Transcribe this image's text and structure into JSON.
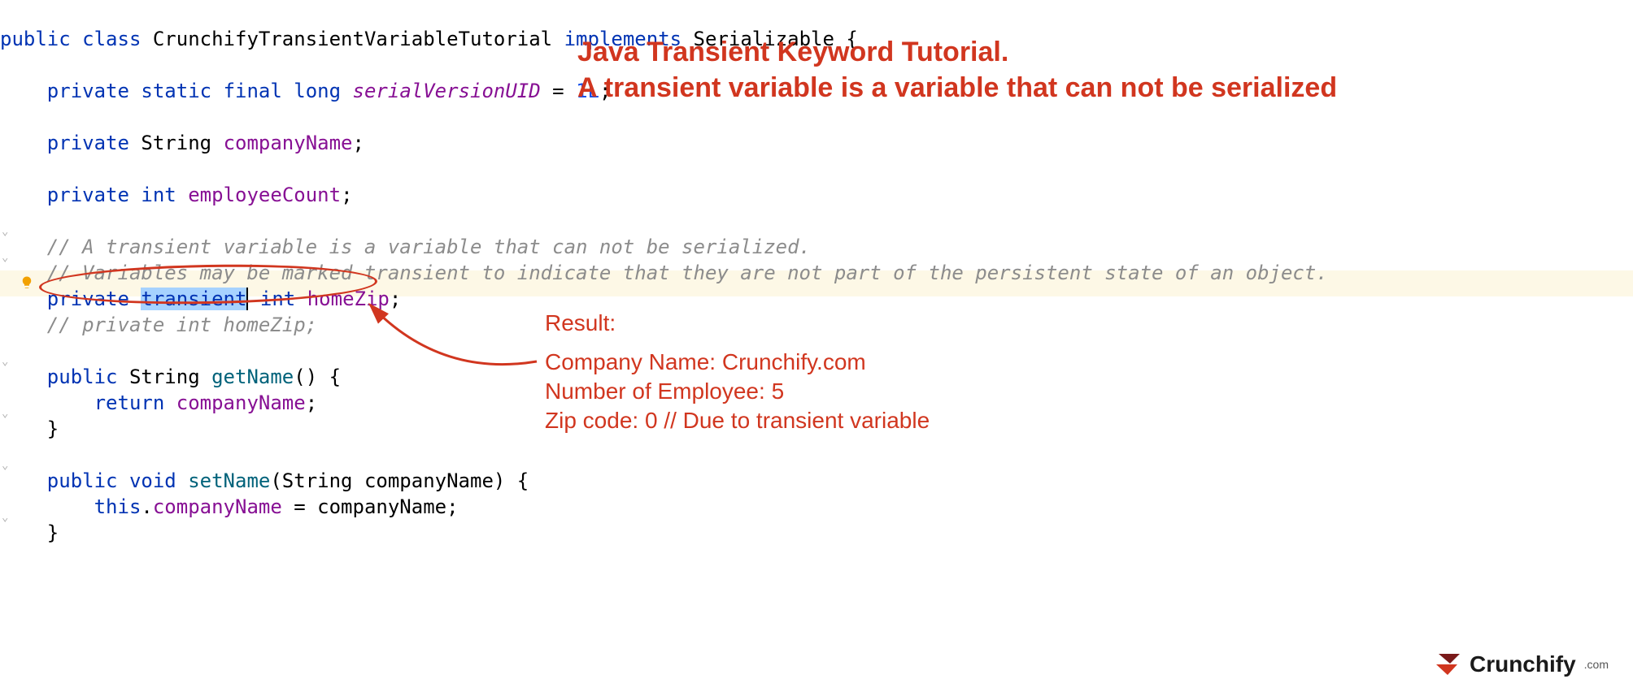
{
  "code": {
    "l1": {
      "kw1": "public",
      "kw2": "class",
      "name": "CrunchifyTransientVariableTutorial",
      "kw3": "implements",
      "iface": "Serializable",
      "end": " {"
    },
    "l3": {
      "kw1": "private",
      "kw2": "static",
      "kw3": "final",
      "kw4": "long",
      "field": "serialVersionUID",
      "eq": " = ",
      "val": "1L",
      "end": ";"
    },
    "l5": {
      "kw": "private",
      "type": "String",
      "field": "companyName",
      "end": ";"
    },
    "l7": {
      "kw": "private",
      "type": "int",
      "field": "employeeCount",
      "end": ";"
    },
    "l9": {
      "comment": "// A transient variable is a variable that can not be serialized."
    },
    "l10": {
      "comment": "// Variables may be marked transient to indicate that they are not part of the persistent state of an object."
    },
    "l11": {
      "kw": "private",
      "sel": "transient",
      "type": "int",
      "field": "homeZip",
      "end": ";"
    },
    "l12": {
      "comment": "// private int homeZip;"
    },
    "l14": {
      "kw": "public",
      "type": "String",
      "method": "getName",
      "sig": "() {"
    },
    "l15": {
      "kw": "return",
      "field": "companyName",
      "end": ";"
    },
    "l16": {
      "brace": "}"
    },
    "l18": {
      "kw1": "public",
      "kw2": "void",
      "method": "setName",
      "sig": "(String companyName) {"
    },
    "l19": {
      "kw": "this",
      "dot": ".",
      "field": "companyName",
      "eq": " = companyName;"
    },
    "l20": {
      "brace": "}"
    }
  },
  "annotation": {
    "title_l1": "Java Transient Keyword Tutorial.",
    "title_l2": " A transient variable is a variable that can not be serialized",
    "result_header": "Result:",
    "result_l1": "Company Name: Crunchify.com",
    "result_l2": "Number of Employee: 5",
    "result_l3": "Zip code: 0 // Due to transient variable"
  },
  "logo": {
    "name": "Crunchify",
    "suffix": ".com"
  }
}
